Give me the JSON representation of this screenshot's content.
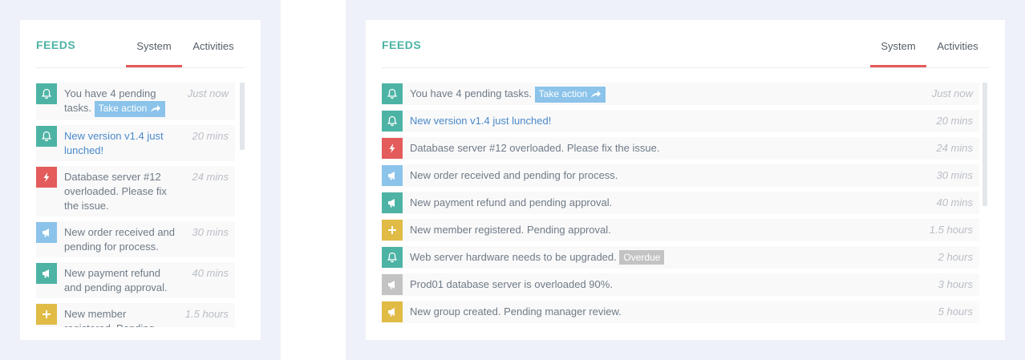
{
  "panel_title": "FEEDS",
  "tabs": [
    {
      "label": "System",
      "active": true
    },
    {
      "label": "Activities",
      "active": false
    }
  ],
  "colors": {
    "accent": "#4db3a5",
    "tab_active": "#e35b5a",
    "link": "#4a89c8"
  },
  "feeds": [
    {
      "icon": "bell-icon",
      "color": "#4db3a5",
      "text": "You have 4 pending tasks.",
      "badge": "Take action",
      "badge_icon": "share-icon",
      "link": false,
      "time": "Just now"
    },
    {
      "icon": "bell-icon",
      "color": "#4db3a5",
      "text": "New version v1.4 just lunched!",
      "link": true,
      "time": "20 mins"
    },
    {
      "icon": "bolt-icon",
      "color": "#e35b5a",
      "text": "Database server #12 overloaded. Please fix the issue.",
      "link": false,
      "time": "24 mins"
    },
    {
      "icon": "megaphone-icon",
      "color": "#8bc3ea",
      "text": "New order received and pending for process.",
      "link": false,
      "time": "30 mins"
    },
    {
      "icon": "megaphone-icon",
      "color": "#4db3a5",
      "text": "New payment refund and pending approval.",
      "link": false,
      "time": "40 mins"
    },
    {
      "icon": "plus-icon",
      "color": "#e0bb45",
      "text": "New member registered. Pending approval.",
      "link": false,
      "time": "1.5 hours"
    },
    {
      "icon": "bell-icon",
      "color": "#4db3a5",
      "text": "Web server hardware needs to be upgraded.",
      "badge": "Overdue",
      "link": false,
      "time": "2 hours"
    },
    {
      "icon": "megaphone-icon",
      "color": "#c3c3c3",
      "text": "Prod01 database server is overloaded 90%.",
      "link": false,
      "time": "3 hours"
    },
    {
      "icon": "megaphone-icon",
      "color": "#e0bb45",
      "text": "New group created. Pending manager review.",
      "link": false,
      "time": "5 hours"
    }
  ]
}
